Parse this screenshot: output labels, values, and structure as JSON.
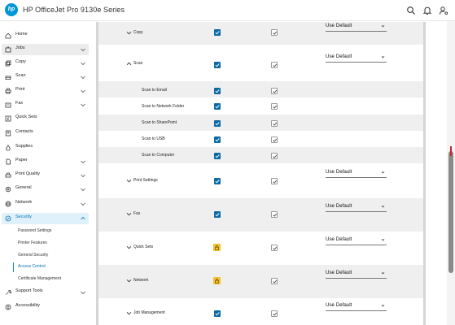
{
  "header": {
    "logo_text": "hp",
    "title": "HP OfficeJet Pro 9130e Series",
    "icons": [
      "search-icon",
      "bell-icon",
      "user-settings-icon"
    ]
  },
  "sidebar": {
    "items": [
      {
        "label": "Home",
        "icon": "home-icon"
      },
      {
        "label": "Jobs",
        "icon": "jobs-icon"
      },
      {
        "label": "Copy",
        "icon": "copy-icon"
      },
      {
        "label": "Scan",
        "icon": "scan-icon"
      },
      {
        "label": "Print",
        "icon": "print-icon"
      },
      {
        "label": "Fax",
        "icon": "fax-icon"
      },
      {
        "label": "Quick Sets",
        "icon": "quick-sets-icon"
      },
      {
        "label": "Contacts",
        "icon": "contacts-icon"
      },
      {
        "label": "Supplies",
        "icon": "supplies-icon"
      },
      {
        "label": "Paper",
        "icon": "paper-icon"
      },
      {
        "label": "Print Quality",
        "icon": "print-quality-icon"
      },
      {
        "label": "General",
        "icon": "general-icon"
      },
      {
        "label": "Network",
        "icon": "network-icon"
      },
      {
        "label": "Security",
        "icon": "security-icon"
      },
      {
        "label": "Support Tools",
        "icon": "support-tools-icon"
      },
      {
        "label": "Accessibility",
        "icon": "accessibility-icon"
      }
    ],
    "security_sub": [
      {
        "label": "Password Settings"
      },
      {
        "label": "Printer Features"
      },
      {
        "label": "General Security"
      },
      {
        "label": "Access Control"
      },
      {
        "label": "Certificate Management"
      }
    ]
  },
  "table": {
    "rows": [
      {
        "label": "Copy",
        "col1": "checked",
        "col2": "checked",
        "select": "Use Default"
      },
      {
        "label": "Scan",
        "col1": "checked",
        "col2": "checked",
        "select": "Use Default"
      },
      {
        "label": "Scan to Email",
        "col1": "checked",
        "col2": "checked"
      },
      {
        "label": "Scan to Network Folder",
        "col1": "checked",
        "col2": "checked"
      },
      {
        "label": "Scan to SharePoint",
        "col1": "checked",
        "col2": "checked"
      },
      {
        "label": "Scan to USB",
        "col1": "checked",
        "col2": "checked"
      },
      {
        "label": "Scan to Computer",
        "col1": "checked",
        "col2": "checked"
      },
      {
        "label": "Print Settings",
        "col1": "checked",
        "col2": "checked",
        "select": "Use Default"
      },
      {
        "label": "Fax",
        "col1": "checked",
        "col2": "checked",
        "select": "Use Default"
      },
      {
        "label": "Quick Sets",
        "col1": "locked",
        "col2": "checked",
        "select": "Use Default"
      },
      {
        "label": "Network",
        "col1": "locked",
        "col2": "checked",
        "select": "Use Default"
      },
      {
        "label": "Job Management",
        "col1": "checked",
        "col2": "checked",
        "select": "Use Default"
      }
    ]
  },
  "colors": {
    "accent": "#0096d6",
    "checkbox_blue": "#0b6aa3",
    "lock_yellow": "#f2c230",
    "active_nav_bg": "#dff1fb"
  }
}
